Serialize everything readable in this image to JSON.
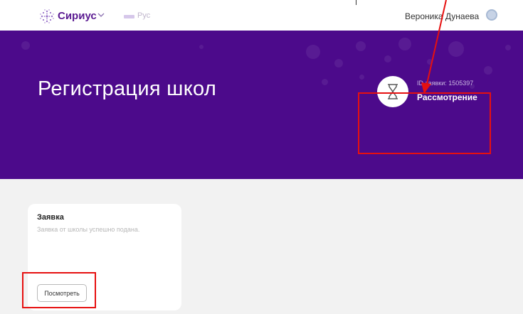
{
  "header": {
    "brand": "Сириус",
    "brand_icon": "sirius-logo-icon",
    "chevron_icon": "chevron-down-icon",
    "language": "Рус",
    "user_name": "Вероника Дунаева",
    "avatar_icon": "user-avatar-icon"
  },
  "hero": {
    "title": "Регистрация школ",
    "application_id": "ID заявки: 1505397",
    "status": "Рассмотрение",
    "status_icon": "hourglass-icon"
  },
  "card": {
    "title": "Заявка",
    "description": "Заявка от школы успешно подана.",
    "view_button_label": "Посмотреть"
  },
  "colors": {
    "hero_background": "#4c0a8b",
    "brand": "#5a1a91",
    "annotation": "#e61010"
  }
}
